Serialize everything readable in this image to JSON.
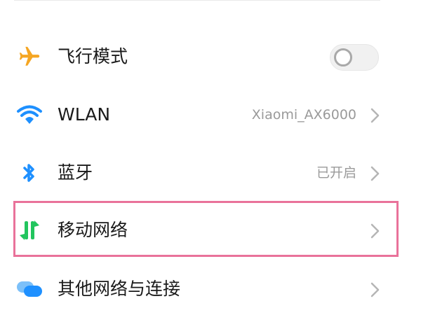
{
  "settings": {
    "items": [
      {
        "label": "飞行模式",
        "icon": "airplane-icon",
        "control": "toggle",
        "toggle_on": false
      },
      {
        "label": "WLAN",
        "icon": "wifi-icon",
        "value": "Xiaomi_AX6000",
        "control": "chevron"
      },
      {
        "label": "蓝牙",
        "icon": "bluetooth-icon",
        "value": "已开启",
        "control": "chevron"
      },
      {
        "label": "移动网络",
        "icon": "mobile-data-icon",
        "control": "chevron",
        "highlighted": true
      },
      {
        "label": "其他网络与连接",
        "icon": "cloud-connection-icon",
        "control": "chevron"
      }
    ]
  },
  "colors": {
    "airplane": "#F5A623",
    "wifi": "#1E90FF",
    "bluetooth": "#1E90FF",
    "mobile_data": "#22C55E",
    "cloud": "#1E90FF",
    "highlight_border": "#E9729A"
  }
}
